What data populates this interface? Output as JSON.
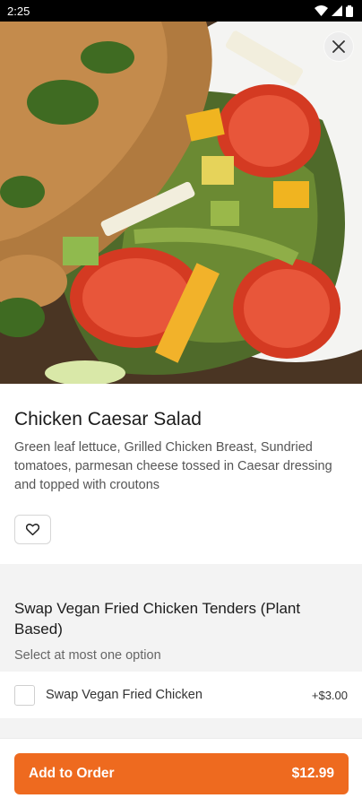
{
  "status_bar": {
    "time": "2:25"
  },
  "item": {
    "title": "Chicken Caesar Salad",
    "description": "Green leaf lettuce, Grilled Chicken Breast, Sundried tomatoes, parmesan cheese tossed in Caesar dressing and topped with croutons"
  },
  "modifier_group": {
    "title": "Swap Vegan Fried Chicken Tenders (Plant Based)",
    "subtitle": "Select at most one option",
    "options": [
      {
        "label": "Swap Vegan Fried Chicken",
        "price": "+$3.00",
        "checked": false
      }
    ]
  },
  "cart": {
    "add_label": "Add to Order",
    "total": "$12.99"
  },
  "colors": {
    "accent": "#ee6a1f",
    "section_bg": "#f3f3f3"
  },
  "icons": {
    "close": "close-icon",
    "favorite": "heart-icon",
    "wifi": "wifi-icon",
    "signal": "signal-icon",
    "battery": "battery-icon"
  }
}
